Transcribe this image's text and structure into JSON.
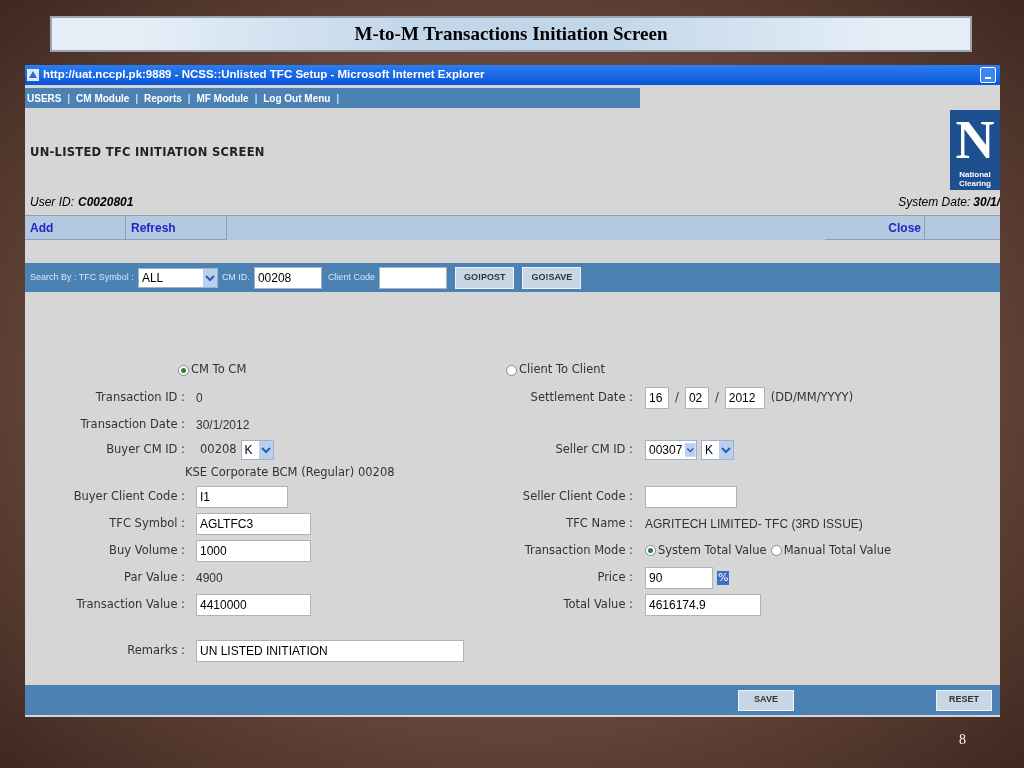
{
  "slide": {
    "title": "M-to-M Transactions Initiation Screen",
    "page_number": "8"
  },
  "window": {
    "title": "http://uat.nccpl.pk:9889 - NCSS::Unlisted TFC Setup - Microsoft Internet Explorer"
  },
  "menu": {
    "separator": "|",
    "items": [
      "USERS",
      "CM Module",
      "Reports",
      "MF Module",
      "Log Out Menu"
    ]
  },
  "logo": {
    "letter": "N",
    "caption": "National Clearing"
  },
  "heading": "UN-LISTED TFC INITIATION SCREEN",
  "user_id": {
    "label": "User ID:",
    "value": "C0020801"
  },
  "system_date": {
    "label": "System Date:",
    "value": "30/1/"
  },
  "actions": [
    "Add",
    "Refresh"
  ],
  "close": "Close",
  "search": {
    "label": "Search By : TFC Symbol :",
    "symbol": "ALL",
    "cm_id_label": "CM ID.",
    "cm_id": "00208",
    "client_code_label": "Client Code",
    "buttons": [
      "GO!POST",
      "GO!SAVE"
    ]
  },
  "transfer_type": [
    {
      "label": "CM To CM",
      "selected": true
    },
    {
      "label": "Client To Client",
      "selected": false
    }
  ],
  "rows": [
    {
      "left": {
        "kind": "text",
        "label": "Transaction ID :",
        "value": "0"
      },
      "right": {
        "kind": "date",
        "label": "Settlement Date :",
        "parts": [
          "16",
          "02",
          "2012"
        ],
        "separator": "/",
        "hint": "(DD/MM/YYYY)"
      }
    },
    {
      "left": {
        "kind": "text",
        "label": "Transaction Date :",
        "value": "30/1/2012"
      }
    },
    {
      "left": {
        "kind": "selects",
        "label": "Buyer CM ID :",
        "value": "00208",
        "selects": [
          "K"
        ]
      },
      "right": {
        "kind": "selects",
        "label": "Seller CM ID :",
        "selects": [
          "00307",
          "K"
        ]
      }
    },
    {
      "left": {
        "kind": "note",
        "value": "KSE Corporate BCM (Regular) 00208"
      }
    },
    {
      "left": {
        "kind": "short_input",
        "label": "Buyer Client Code :",
        "value": "I1"
      },
      "right": {
        "kind": "short_input",
        "label": "Seller Client Code :"
      }
    },
    {
      "left": {
        "kind": "input",
        "label": "TFC Symbol :",
        "value": "AGLTFC3"
      },
      "right": {
        "kind": "text",
        "label": "TFC Name :",
        "value": "AGRITECH LIMITED- TFC (3RD ISSUE)"
      }
    },
    {
      "left": {
        "kind": "input",
        "label": "Buy Volume :",
        "value": "1000"
      },
      "right": {
        "kind": "radio",
        "label": "Transaction Mode :",
        "options": [
          {
            "label": "System Total Value",
            "selected": true
          },
          {
            "label": "Manual Total Value",
            "selected": false
          }
        ]
      }
    },
    {
      "left": {
        "kind": "text",
        "label": "Par Value :",
        "value": "4900"
      },
      "right": {
        "kind": "price",
        "label": "Price :",
        "value": "90",
        "unit": "%"
      }
    },
    {
      "left": {
        "kind": "input",
        "label": "Transaction Value :",
        "value": "4410000"
      },
      "right": {
        "kind": "wide_input",
        "label": "Total Value :",
        "value": "4616174.9"
      }
    }
  ],
  "remarks": {
    "label": "Remarks :",
    "value": "UN LISTED INITIATION"
  },
  "bottom_buttons": [
    "SAVE",
    "RESET"
  ]
}
